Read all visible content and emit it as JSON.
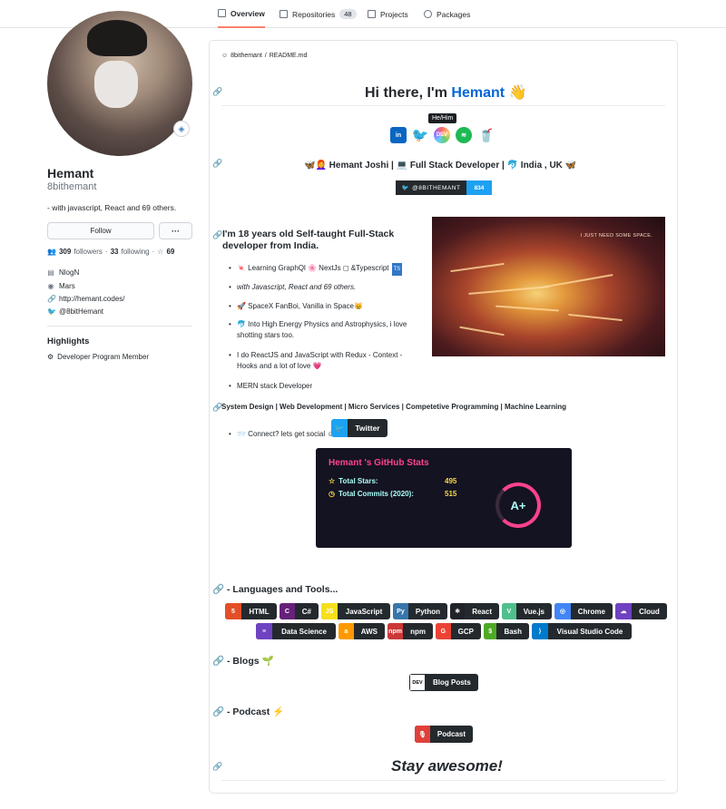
{
  "nav": {
    "tabs": [
      {
        "label": "Overview"
      },
      {
        "label": "Repositories",
        "count": "48"
      },
      {
        "label": "Projects"
      },
      {
        "label": "Packages"
      }
    ]
  },
  "profile": {
    "name": "Hemant",
    "login": "8bithemant",
    "bio": "- with javascript, React and 69 others.",
    "follow_label": "Follow",
    "more_label": "···",
    "followers_count": "309",
    "followers_label": "followers",
    "following_count": "33",
    "following_label": "following",
    "stars_count": "69",
    "org": "NlogN",
    "location": "Mars",
    "website": "http://hemant.codes/",
    "twitter": "@8bitHemant",
    "highlights_title": "Highlights",
    "highlight_item": "Developer Program Member"
  },
  "readme": {
    "path_user": "8bithemant",
    "path_sep": "/",
    "path_file": "README.md",
    "greeting_prefix": "Hi there, I'm ",
    "greeting_name": "Hemant",
    "greeting_emoji": "👋",
    "tooltip": "He/Him",
    "social_icons": [
      "in",
      "tw",
      "dev",
      "sp",
      "bmc"
    ],
    "subline": "🦋👩‍🦰 Hemant Joshi | 💻 Full Stack Developer | 🐬 India , UK 🦋",
    "twitter_badge_label": "@8BITHEMANT",
    "twitter_badge_count": "834",
    "gif_caption": "I JUST NEED SOME SPACE.",
    "intro": "I'm 18 years old Self-taught Full-Stack developer from India.",
    "list": [
      "🍬 Learning GraphQl 🌸 NextJs ◻ &Typescript",
      "with Javascript, React and 69 others.",
      "🚀 SpaceX FanBoi, Vanilla in Space😸",
      "🐬 Into High Energy Physics and Astrophysics, i love shotting stars too.",
      "I do ReactJS and JavaScript with Redux - Context - Hooks and a lot of love 💗",
      "MERN stack Developer"
    ],
    "ts_badge": "TS",
    "skills_line": "System Design | Web Development | Micro Services | Competetive Programming | Machine Learning",
    "connect": "📨 Connect? lets get social ☺",
    "twitter_button": "Twitter",
    "stats": {
      "title": "Hemant 's GitHub Stats",
      "total_stars_label": "Total Stars:",
      "total_stars": "495",
      "total_commits_label": "Total Commits (2020):",
      "total_commits": "515",
      "grade": "A+"
    },
    "languages_title": "- Languages and Tools...",
    "tools_row1": [
      {
        "label": "HTML",
        "color": "#e34f26",
        "icon": "5"
      },
      {
        "label": "C#",
        "color": "#68217a",
        "icon": "C"
      },
      {
        "label": "JavaScript",
        "color": "#f7df1e",
        "icon": "JS"
      },
      {
        "label": "Python",
        "color": "#3776ab",
        "icon": "Py"
      },
      {
        "label": "React",
        "color": "#20232a",
        "icon": "⚛"
      },
      {
        "label": "Vue.js",
        "color": "#4fc08d",
        "icon": "V"
      },
      {
        "label": "Chrome",
        "color": "#4285f4",
        "icon": "◎"
      },
      {
        "label": "Cloud",
        "color": "#6f42c1",
        "icon": "☁"
      }
    ],
    "tools_row2": [
      {
        "label": "Data Science",
        "color": "#6f42c1",
        "icon": "≡"
      },
      {
        "label": "AWS",
        "color": "#ff9900",
        "icon": "a"
      },
      {
        "label": "npm",
        "color": "#cb3837",
        "icon": "npm"
      },
      {
        "label": "GCP",
        "color": "#ea4335",
        "icon": "G"
      },
      {
        "label": "Bash",
        "color": "#4eaa25",
        "icon": "$"
      },
      {
        "label": "Visual Studio Code",
        "color": "#007acc",
        "icon": "⟩"
      }
    ],
    "blogs_title": "- Blogs 🌱",
    "blog_button": "Blog Posts",
    "blog_icon": "DEV",
    "podcast_title": "- Podcast ⚡",
    "podcast_button": "Podcast",
    "podcast_icon": "🎙",
    "footer": "Stay awesome!"
  }
}
